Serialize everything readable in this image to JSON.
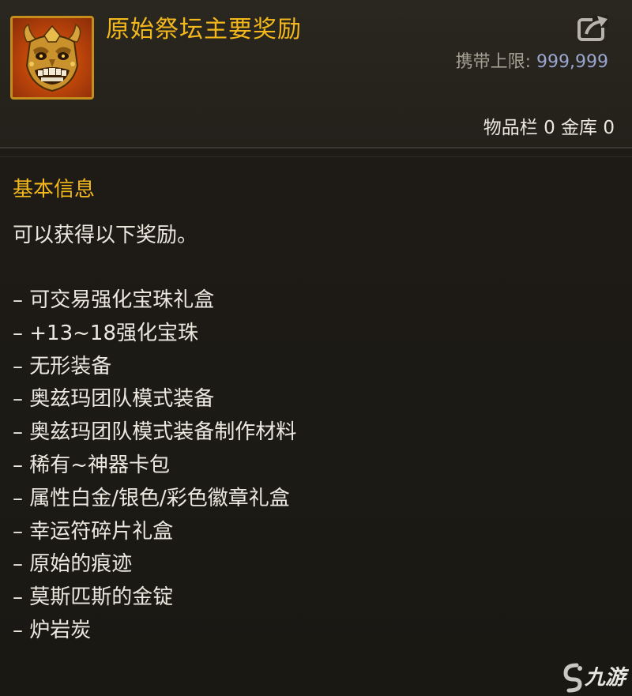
{
  "item": {
    "icon": "demon-mask-icon",
    "title": "原始祭坛主要奖励",
    "carry_limit_label": "携带上限:",
    "carry_limit_value": "999,999",
    "storage_text": "物品栏 0 金库 0"
  },
  "info": {
    "section_title": "基本信息",
    "description": "可以获得以下奖励。",
    "rewards": [
      "– 可交易强化宝珠礼盒",
      "– +13~18强化宝珠",
      "– 无形装备",
      "– 奥兹玛团队模式装备",
      "– 奥兹玛团队模式装备制作材料",
      "– 稀有~神器卡包",
      "– 属性白金/银色/彩色徽章礼盒",
      "– 幸运符碎片礼盒",
      "– 原始的痕迹",
      "– 莫斯匹斯的金锭",
      "– 炉岩炭"
    ]
  },
  "watermark": {
    "text": "九游",
    "icon": "jiuyou-logo-icon"
  },
  "colors": {
    "title": "#f3b81c",
    "body_text": "#ece8df",
    "muted": "#a59f93",
    "value": "#9aa6cf",
    "icon_border": "#c58e1c"
  }
}
